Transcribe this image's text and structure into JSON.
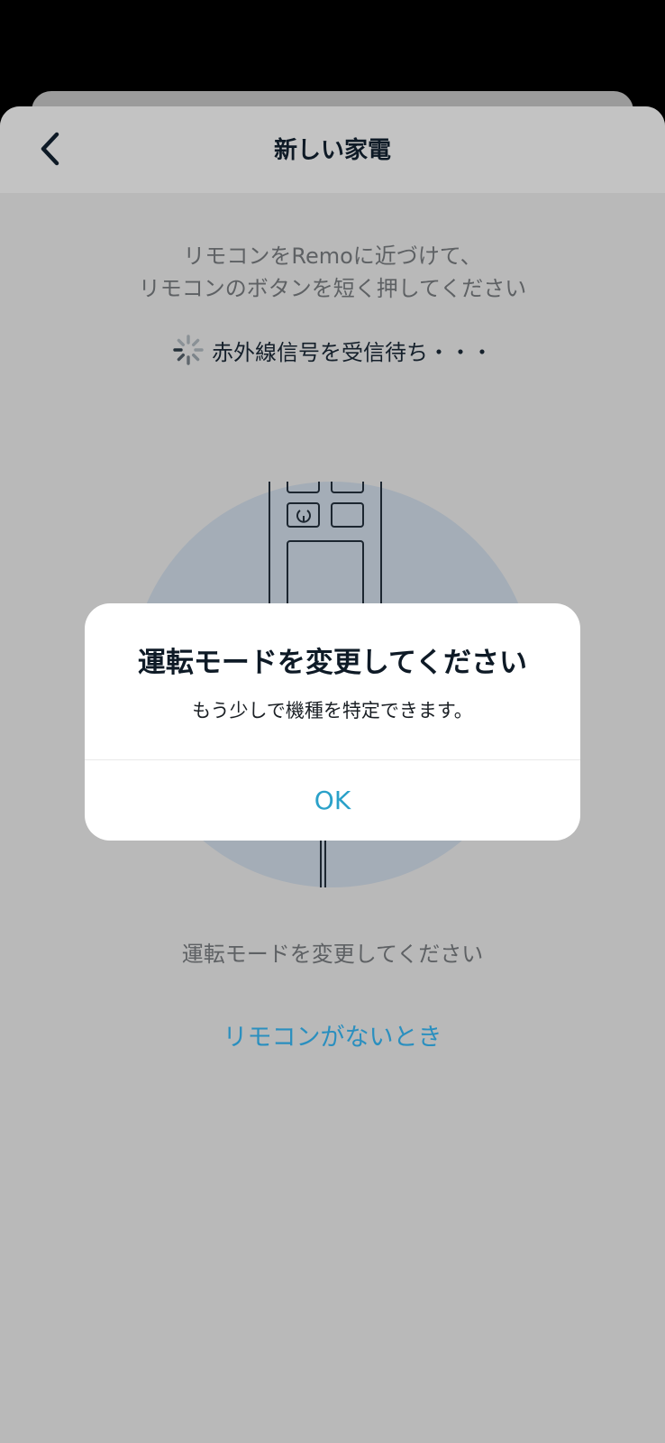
{
  "header": {
    "title": "新しい家電",
    "back_icon": "chevron-left-icon"
  },
  "instruction": {
    "line1": "リモコンをRemoに近づけて、",
    "line2": "リモコンのボタンを短く押してください"
  },
  "status": {
    "text": "赤外線信号を受信待ち・・・",
    "icon": "spinner-icon"
  },
  "illustration": {
    "icon": "remote-control-illustration"
  },
  "bottom": {
    "hint": "運転モードを変更してください",
    "link": "リモコンがないとき"
  },
  "dialog": {
    "title": "運転モードを変更してください",
    "message": "もう少しで機種を特定できます。",
    "ok_label": "OK"
  },
  "colors": {
    "accent": "#2aa1c9",
    "sheet_background": "#b9b9b9",
    "illustration_circle": "#a4adb7"
  }
}
